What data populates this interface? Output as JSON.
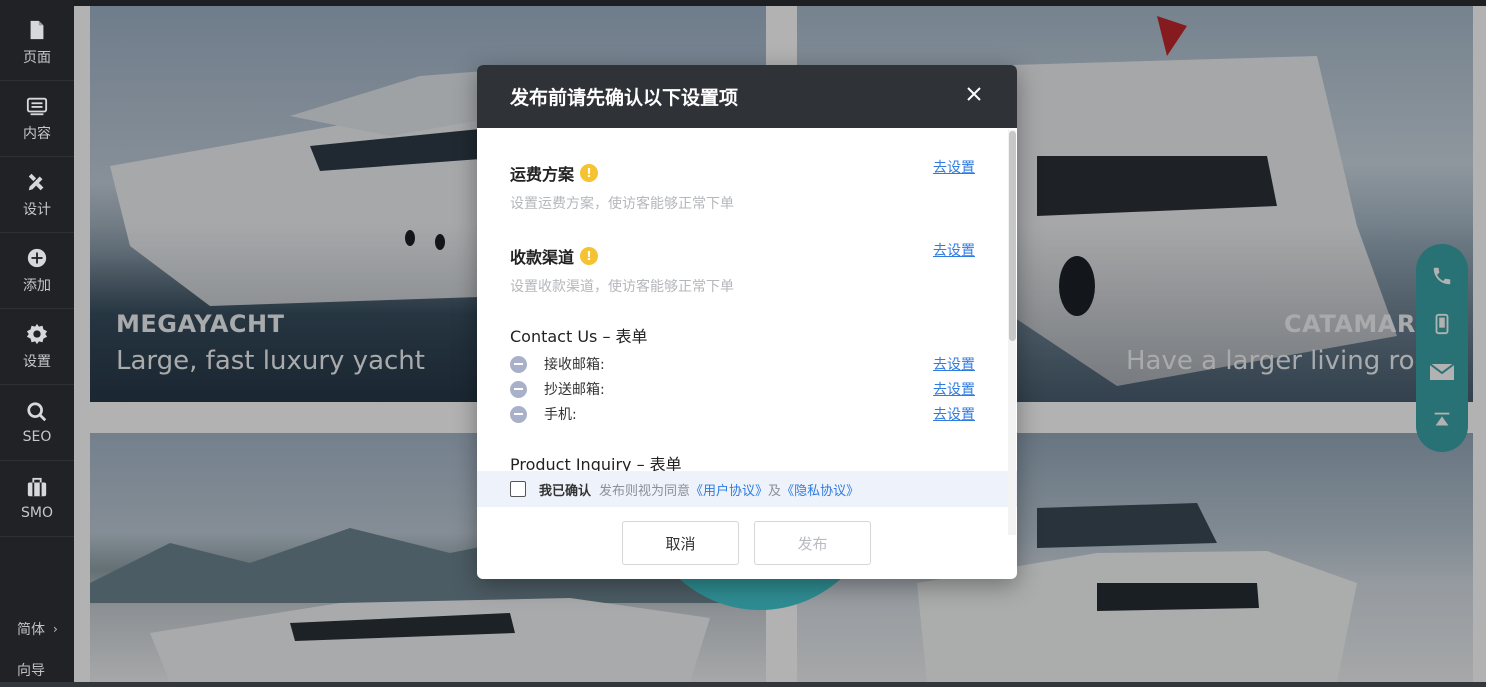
{
  "sidebar": {
    "items": [
      {
        "label": "页面",
        "icon": "page-icon"
      },
      {
        "label": "内容",
        "icon": "content-icon"
      },
      {
        "label": "设计",
        "icon": "design-icon"
      },
      {
        "label": "添加",
        "icon": "add-icon"
      },
      {
        "label": "设置",
        "icon": "gear-icon"
      },
      {
        "label": "SEO",
        "icon": "search-icon"
      },
      {
        "label": "SMO",
        "icon": "briefcase-icon"
      }
    ],
    "language": "简体",
    "guide": "向导"
  },
  "cards": [
    {
      "title": "MEGAYACHT",
      "subtitle": "Large, fast luxury yacht"
    },
    {
      "title": "CATAMARA",
      "subtitle": "Have a larger living roo"
    }
  ],
  "floating_contact": [
    "phone-icon",
    "mobile-icon",
    "mail-icon",
    "back-to-top-icon"
  ],
  "modal": {
    "title": "发布前请先确认以下设置项",
    "sections": [
      {
        "title": "运费方案",
        "desc": "设置运费方案，使访客能够正常下单",
        "link": "去设置"
      },
      {
        "title": "收款渠道",
        "desc": "设置收款渠道，使访客能够正常下单",
        "link": "去设置"
      }
    ],
    "contact_form": {
      "title": "Contact Us – 表单",
      "fields": [
        {
          "label": "接收邮箱:",
          "link": "去设置"
        },
        {
          "label": "抄送邮箱:",
          "link": "去设置"
        },
        {
          "label": "手机:",
          "link": "去设置"
        }
      ]
    },
    "inquiry_form": {
      "title": "Product Inquiry – 表单"
    },
    "agree": {
      "strong": "我已确认",
      "text": "发布则视为同意",
      "user_agreement": "《用户协议》",
      "and": "及",
      "privacy": "《隐私协议》"
    },
    "cancel_label": "取消",
    "publish_label": "发布"
  },
  "colors": {
    "header": "#2f3237",
    "link": "#2f7be0",
    "warning": "#f5c232",
    "teal": "#3aa3a6"
  }
}
